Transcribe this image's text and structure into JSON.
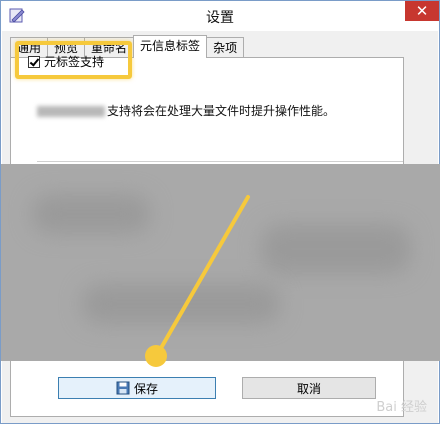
{
  "window": {
    "title": "设置",
    "close_glyph": "✕"
  },
  "tabs": [
    {
      "label": "通用",
      "active": false
    },
    {
      "label": "预览",
      "active": false
    },
    {
      "label": "重命名",
      "active": false
    },
    {
      "label": "元信息标签",
      "active": true
    },
    {
      "label": "杂项",
      "active": false
    }
  ],
  "metadata_panel": {
    "checkbox_label": "元标签支持",
    "checked": true,
    "description_visible": "支持将会在处理大量文件时提升操作性能。"
  },
  "buttons": {
    "save_label": "保存",
    "cancel_label": "取消"
  },
  "watermark": "Bai 经验",
  "colors": {
    "highlight": "#f6c93c",
    "close_button": "#c7372f",
    "obscured_area": "#a9a9a9"
  },
  "icons": {
    "app": "app-icon",
    "save": "floppy-disk-icon",
    "close": "close-icon"
  }
}
